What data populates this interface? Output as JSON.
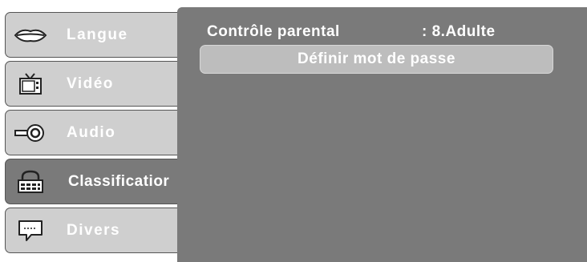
{
  "menu": {
    "tabs": [
      {
        "label": "Langue",
        "icon": "lips-icon"
      },
      {
        "label": "Vidéo",
        "icon": "tv-icon"
      },
      {
        "label": "Audio",
        "icon": "disc-icon"
      },
      {
        "label": "Classificatior",
        "icon": "lock-icon",
        "active": true
      },
      {
        "label": "Divers",
        "icon": "speech-bubble-icon"
      }
    ]
  },
  "panel": {
    "setting_label": "Contrôle parental",
    "setting_value": ": 8.Adulte",
    "button_label": "Définir mot de passe"
  },
  "colors": {
    "tab_inactive": "#cfcfcf",
    "tab_active": "#7a7a7a",
    "panel_bg": "#7a7a7a",
    "button_bg": "#bdbdbd",
    "text": "#ffffff"
  }
}
